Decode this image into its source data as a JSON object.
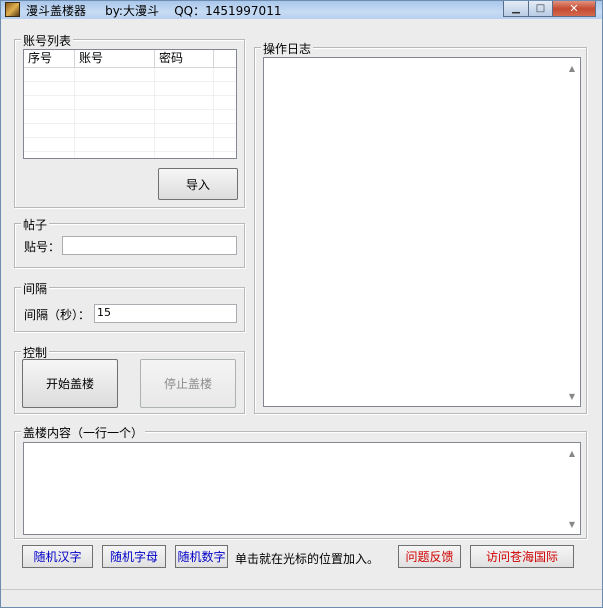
{
  "window": {
    "title": "漫斗盖楼器     by:大漫斗    QQ：1451997011",
    "min_glyph": "▁",
    "max_glyph": "□",
    "close_glyph": "✕",
    "icon": "app-icon"
  },
  "accounts": {
    "legend": "账号列表",
    "columns": [
      "序号",
      "账号",
      "密码"
    ],
    "import_label": "导入"
  },
  "post": {
    "legend": "帖子",
    "label": "贴号：",
    "value": ""
  },
  "interval": {
    "legend": "间隔",
    "label": "间隔（秒）：",
    "value": "15"
  },
  "control": {
    "legend": "控制",
    "start_label": "开始盖楼",
    "stop_label": "停止盖楼"
  },
  "log": {
    "legend": "操作日志",
    "content": ""
  },
  "content": {
    "legend": "盖楼内容（一行一个）",
    "text": ""
  },
  "bottom": {
    "random_chinese": "随机汉字",
    "random_letters": "随机字母",
    "random_digits": "随机数字",
    "hint": "单击就在光标的位置加入。",
    "feedback": "问题反馈",
    "visit": "访问苍海国际"
  },
  "colors": {
    "blue_text": "#0000c8",
    "red_text": "#d00000"
  }
}
